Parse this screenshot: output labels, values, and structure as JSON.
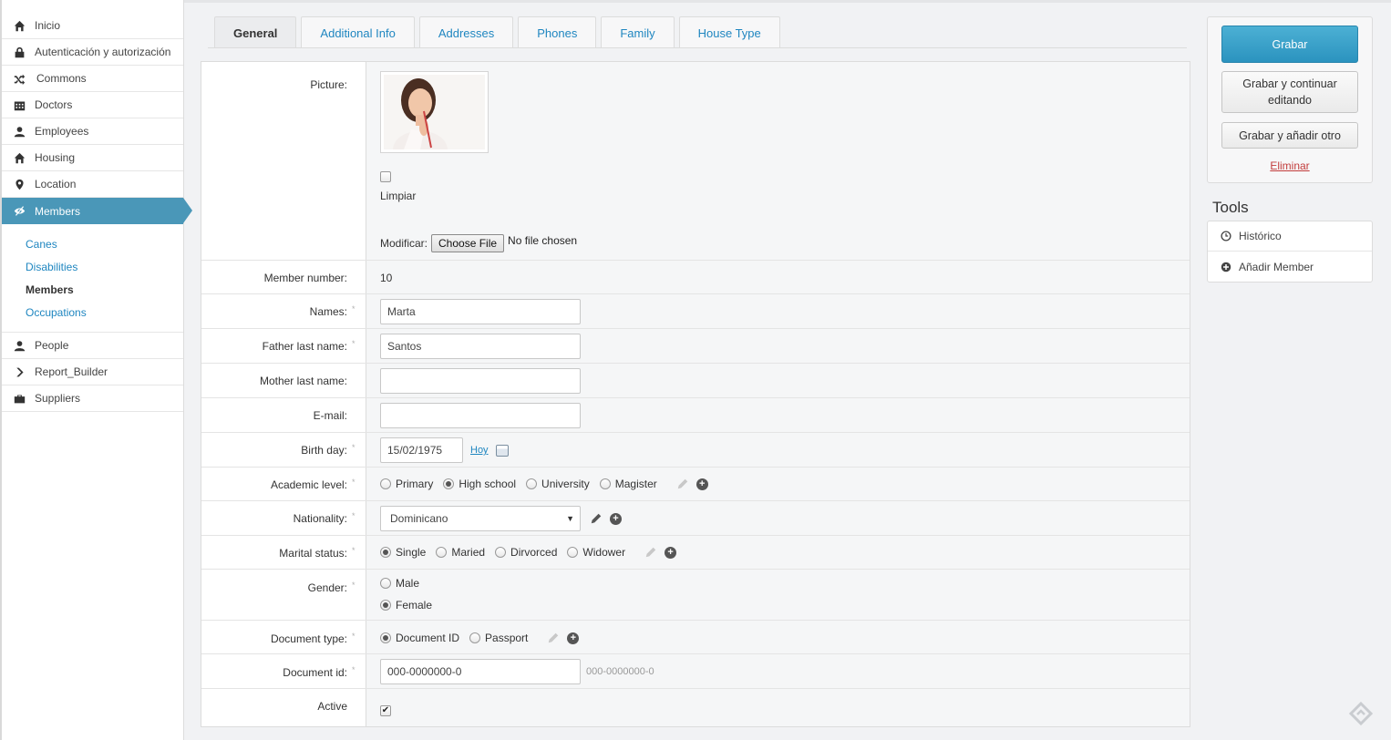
{
  "sidebar": {
    "items": [
      {
        "label": "Inicio",
        "icon": "home-icon"
      },
      {
        "label": "Autenticación y autorización",
        "icon": "lock-icon"
      },
      {
        "label": "Commons",
        "icon": "shuffle-icon"
      },
      {
        "label": "Doctors",
        "icon": "calendar-icon"
      },
      {
        "label": "Employees",
        "icon": "user-icon"
      },
      {
        "label": "Housing",
        "icon": "home-icon"
      },
      {
        "label": "Location",
        "icon": "map-marker-icon"
      },
      {
        "label": "Members",
        "icon": "eye-slash-icon"
      },
      {
        "label": "People",
        "icon": "user-icon"
      },
      {
        "label": "Report_Builder",
        "icon": "chevron-right-icon"
      },
      {
        "label": "Suppliers",
        "icon": "briefcase-icon"
      }
    ],
    "subitems": [
      "Canes",
      "Disabilities",
      "Members",
      "Occupations"
    ]
  },
  "tabs": [
    "General",
    "Additional Info",
    "Addresses",
    "Phones",
    "Family",
    "House Type"
  ],
  "form": {
    "picture": {
      "label": "Picture:",
      "clear_label": "Limpiar",
      "change_label": "Modificar:",
      "choose_file": "Choose File",
      "no_file": "No file chosen"
    },
    "member_number": {
      "label": "Member number:",
      "value": "10"
    },
    "names": {
      "label": "Names:",
      "value": "Marta"
    },
    "father_last_name": {
      "label": "Father last name:",
      "value": "Santos"
    },
    "mother_last_name": {
      "label": "Mother last name:",
      "value": ""
    },
    "email": {
      "label": "E-mail:",
      "value": ""
    },
    "birth_day": {
      "label": "Birth day:",
      "value": "15/02/1975",
      "today_link": "Hoy"
    },
    "academic_level": {
      "label": "Academic level:",
      "options": [
        "Primary",
        "High school",
        "University",
        "Magister"
      ],
      "selected": "High school"
    },
    "nationality": {
      "label": "Nationality:",
      "value": "Dominicano"
    },
    "marital_status": {
      "label": "Marital status:",
      "options": [
        "Single",
        "Maried",
        "Dirvorced",
        "Widower"
      ],
      "selected": "Single"
    },
    "gender": {
      "label": "Gender:",
      "options": [
        "Male",
        "Female"
      ],
      "selected": "Female"
    },
    "document_type": {
      "label": "Document type:",
      "options": [
        "Document ID",
        "Passport"
      ],
      "selected": "Document ID"
    },
    "document_id": {
      "label": "Document id:",
      "value": "000-0000000-0",
      "hint": "000-0000000-0"
    },
    "active": {
      "label": "Active",
      "checked": true
    },
    "required_mark": "*"
  },
  "actions": {
    "save": "Grabar",
    "save_continue": "Grabar y continuar editando",
    "save_add": "Grabar y añadir otro",
    "delete": "Eliminar"
  },
  "tools": {
    "title": "Tools",
    "items": [
      {
        "label": "Histórico",
        "icon": "clock-icon"
      },
      {
        "label": "Añadir Member",
        "icon": "plus-circle-icon"
      }
    ]
  },
  "colors": {
    "accent": "#4a97b8",
    "link": "#1f86c0",
    "danger": "#c23c3c"
  }
}
